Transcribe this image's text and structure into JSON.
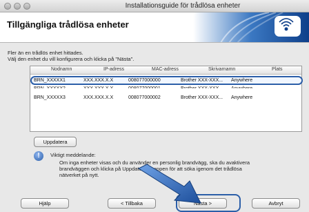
{
  "window": {
    "title": "Installationsguide för trådlösa enheter"
  },
  "header": {
    "title": "Tillgängliga trådlösa enheter"
  },
  "instructions": {
    "line1": "Fler än en trådlös enhet hittades.",
    "line2": "Välj den enhet du vill konfigurera och klicka på \"Nästa\"."
  },
  "table": {
    "columns": [
      "Nodnamn",
      "IP-adress",
      "MAC-adress",
      "Skrivarnamn",
      "Plats"
    ],
    "rows": [
      {
        "name": "BRN_XXXXX1",
        "ip": "XXX.XXX.X.X",
        "mac": "008077000000",
        "model": "Brother XXX-XXX...",
        "location": "Anywhere",
        "selected": true
      },
      {
        "name": "BRN_XXXXX2",
        "ip": "XXX.XXX.X.X",
        "mac": "008077000001",
        "model": "Brother XXX-XXX...",
        "location": "Anywhere",
        "selected": false
      },
      {
        "name": "BRN_XXXXX3",
        "ip": "XXX.XXX.X.X",
        "mac": "008077000002",
        "model": "Brother XXX-XXX...",
        "location": "Anywhere",
        "selected": false
      }
    ]
  },
  "buttons": {
    "update": "Uppdatera",
    "help": "Hjälp",
    "back": "< Tillbaka",
    "next": "Nästa >",
    "cancel": "Avbryt"
  },
  "notice": {
    "title": "Viktigt meddelande:",
    "text_visible_line1": "Om inga enheter visas och du använder en personlig brandvägg, ska du avaktivera",
    "text_visible_line2": "brandväggen och klicka på Uppdatera-knappen för att söka igenom det trådlösa",
    "text_visible_line3": "nätverket på nytt."
  },
  "colors": {
    "accent": "#2b5ea8",
    "header_bg": "#ffffff",
    "window_bg": "#e8e8e8"
  },
  "icons": {
    "header_logo": "wireless-icon",
    "notice": "info-icon",
    "pointer": "arrow-pointer-icon"
  }
}
